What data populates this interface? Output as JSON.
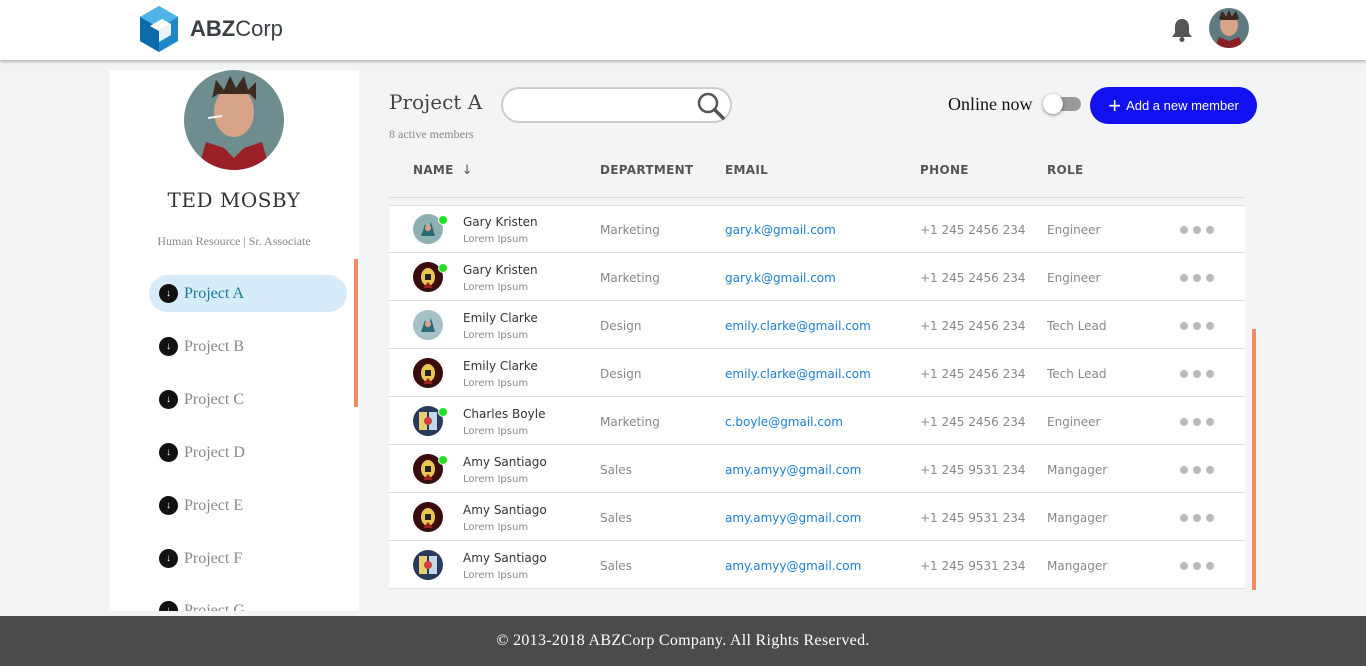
{
  "header": {
    "brand_bold": "ABZ",
    "brand_rest": "Corp",
    "icons": [
      "logo-icon",
      "bell-icon",
      "user-avatar"
    ]
  },
  "profile": {
    "name": "TED MOSBY",
    "role": "Human Resource | Sr. Associate"
  },
  "projects": [
    {
      "label": "Project A",
      "active": true
    },
    {
      "label": "Project B"
    },
    {
      "label": "Project C"
    },
    {
      "label": "Project D"
    },
    {
      "label": "Project E"
    },
    {
      "label": "Project F"
    },
    {
      "label": "Project G"
    }
  ],
  "main": {
    "title": "Project A",
    "subtitle": "8 active members",
    "search_placeholder": "",
    "online_label": "Online now",
    "add_button": "Add a new member"
  },
  "table": {
    "headers": {
      "name": "NAME",
      "department": "DEPARTMENT",
      "email": "EMAIL",
      "phone": "PHONE",
      "role": "ROLE"
    },
    "rows": [
      {
        "name": "Gary Kristen",
        "sub": "Lorem Ipsum",
        "department": "Marketing",
        "email": "gary.k@gmail.com",
        "phone": "+1 245 2456 234",
        "role": "Engineer",
        "online": true
      },
      {
        "name": "Gary Kristen",
        "sub": "Lorem Ipsum",
        "department": "Marketing",
        "email": "gary.k@gmail.com",
        "phone": "+1 245 2456 234",
        "role": "Engineer",
        "online": true
      },
      {
        "name": "Emily Clarke",
        "sub": "Lorem Ipsum",
        "department": "Design",
        "email": "emily.clarke@gmail.com",
        "phone": "+1 245 2456 234",
        "role": "Tech Lead",
        "online": false
      },
      {
        "name": "Emily Clarke",
        "sub": "Lorem Ipsum",
        "department": "Design",
        "email": "emily.clarke@gmail.com",
        "phone": "+1 245 2456 234",
        "role": "Tech Lead",
        "online": false
      },
      {
        "name": "Charles Boyle",
        "sub": "Lorem Ipsum",
        "department": "Marketing",
        "email": "c.boyle@gmail.com",
        "phone": "+1 245 2456 234",
        "role": "Engineer",
        "online": true
      },
      {
        "name": "Amy Santiago",
        "sub": "Lorem Ipsum",
        "department": "Sales",
        "email": "amy.amyy@gmail.com",
        "phone": "+1 245 9531 234",
        "role": "Mangager",
        "online": true
      },
      {
        "name": "Amy Santiago",
        "sub": "Lorem Ipsum",
        "department": "Sales",
        "email": "amy.amyy@gmail.com",
        "phone": "+1 245 9531 234",
        "role": "Mangager",
        "online": false
      },
      {
        "name": "Amy Santiago",
        "sub": "Lorem Ipsum",
        "department": "Sales",
        "email": "amy.amyy@gmail.com",
        "phone": "+1 245 9531 234",
        "role": "Mangager",
        "online": false
      }
    ]
  },
  "footer": {
    "text": "© 2013-2018 ABZCorp Company. All Rights Reserved."
  },
  "colors": {
    "accent": "#1010f0",
    "link": "#1a7fcf",
    "scrollbar": "#f08a62",
    "online": "#22e022",
    "footer_bg": "#4a4b4a"
  }
}
